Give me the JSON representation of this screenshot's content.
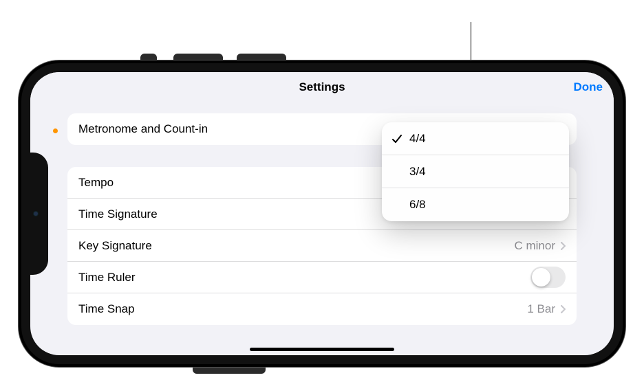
{
  "navbar": {
    "title": "Settings",
    "done": "Done"
  },
  "group1": {
    "metronome_label": "Metronome and Count-in"
  },
  "group2": {
    "tempo_label": "Tempo",
    "time_sig_label": "Time Signature",
    "time_sig_value": "4/4",
    "key_sig_label": "Key Signature",
    "key_sig_value": "C minor",
    "time_ruler_label": "Time Ruler",
    "time_snap_label": "Time Snap",
    "time_snap_value": "1 Bar"
  },
  "popover": {
    "options": {
      "opt0": "4/4",
      "opt1": "3/4",
      "opt2": "6/8"
    },
    "selected_index": 0
  }
}
